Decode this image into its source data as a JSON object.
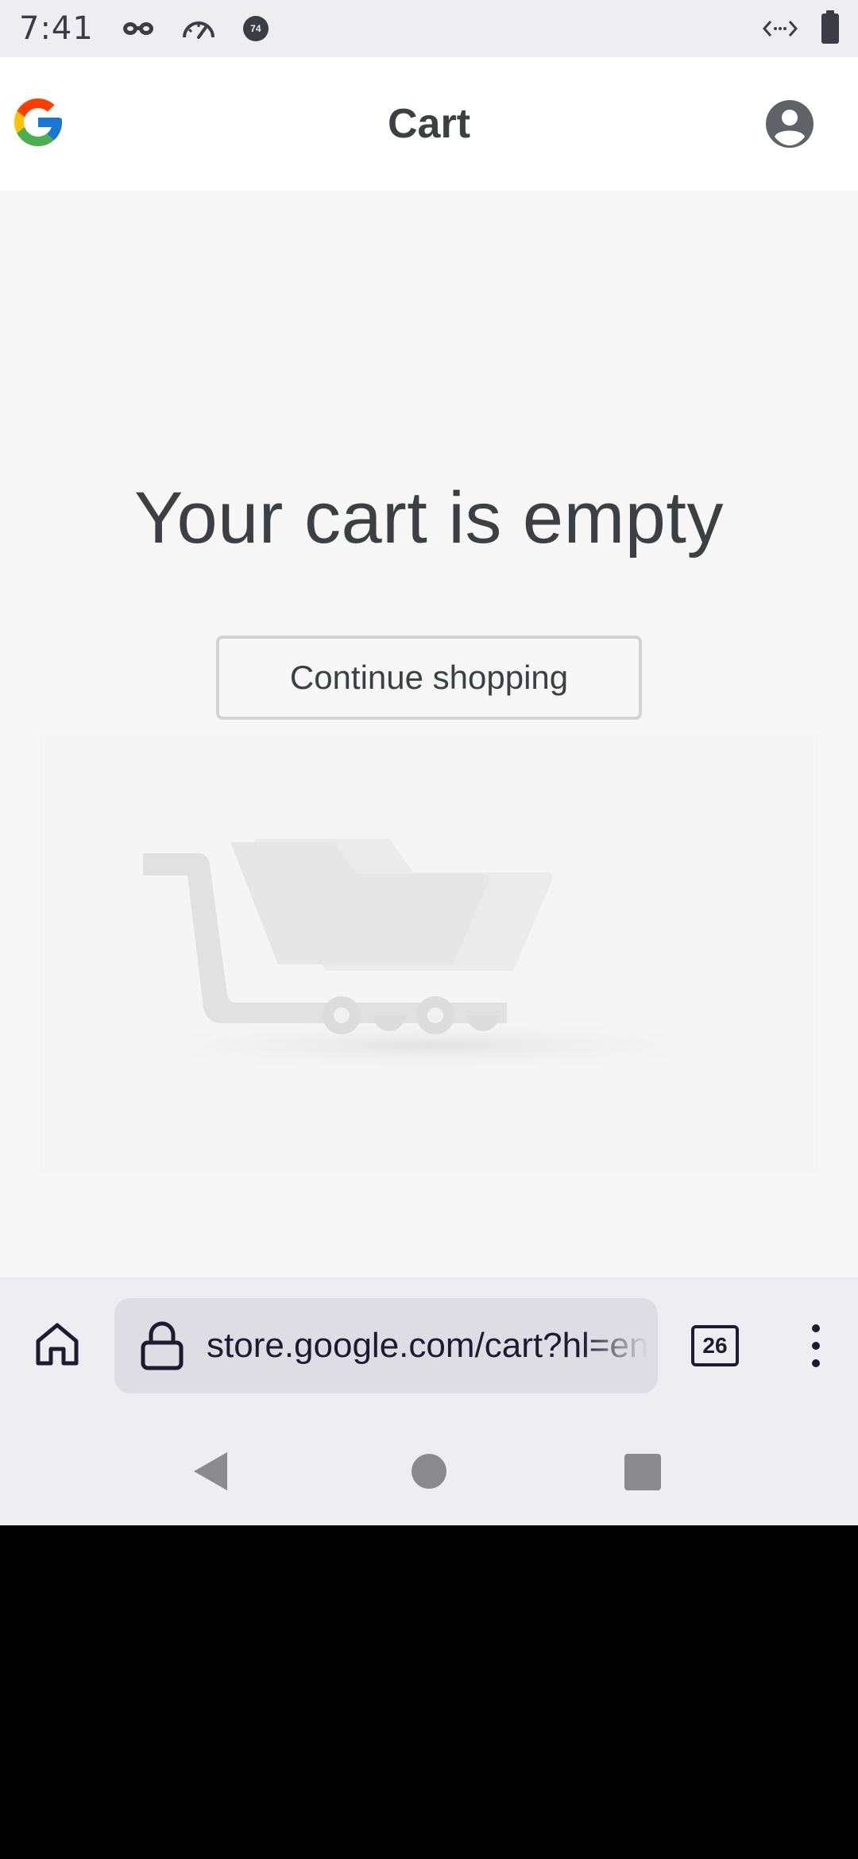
{
  "status_bar": {
    "time": "7:41",
    "icons": [
      "incognito-icon",
      "speedometer-icon",
      "notification-badge-icon",
      "code-icon",
      "battery-icon"
    ],
    "badge_text": "74"
  },
  "header": {
    "title": "Cart",
    "logo": "google-logo",
    "account_icon": "account-circle-icon"
  },
  "main": {
    "empty_title": "Your cart is empty",
    "continue_label": "Continue shopping",
    "illustration": "shopping-cart-illustration"
  },
  "browser": {
    "url": "store.google.com/cart?hl=en",
    "tabs_count": "26",
    "colors": {
      "bar": "#eeedf2",
      "url_box": "#dedde3",
      "ink": "#1d1b30"
    }
  },
  "nav": {
    "items": [
      "back-icon",
      "home-icon",
      "recents-icon"
    ]
  }
}
